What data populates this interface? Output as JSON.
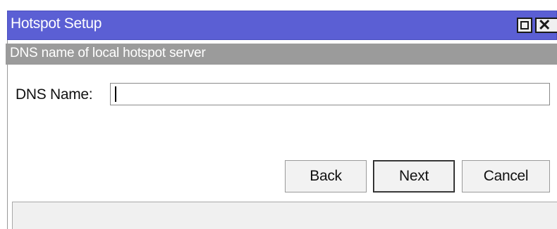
{
  "window": {
    "title": "Hotspot Setup",
    "titlebar_color": "#5b5fd4",
    "maximize_icon": "maximize-icon",
    "close_icon": "close-icon"
  },
  "section": {
    "header": "DNS name of local hotspot server",
    "header_color": "#9b9b9b"
  },
  "form": {
    "dns_label": "DNS Name:",
    "dns_value": ""
  },
  "buttons": {
    "back": "Back",
    "next": "Next",
    "cancel": "Cancel"
  },
  "status": {
    "text": ""
  }
}
